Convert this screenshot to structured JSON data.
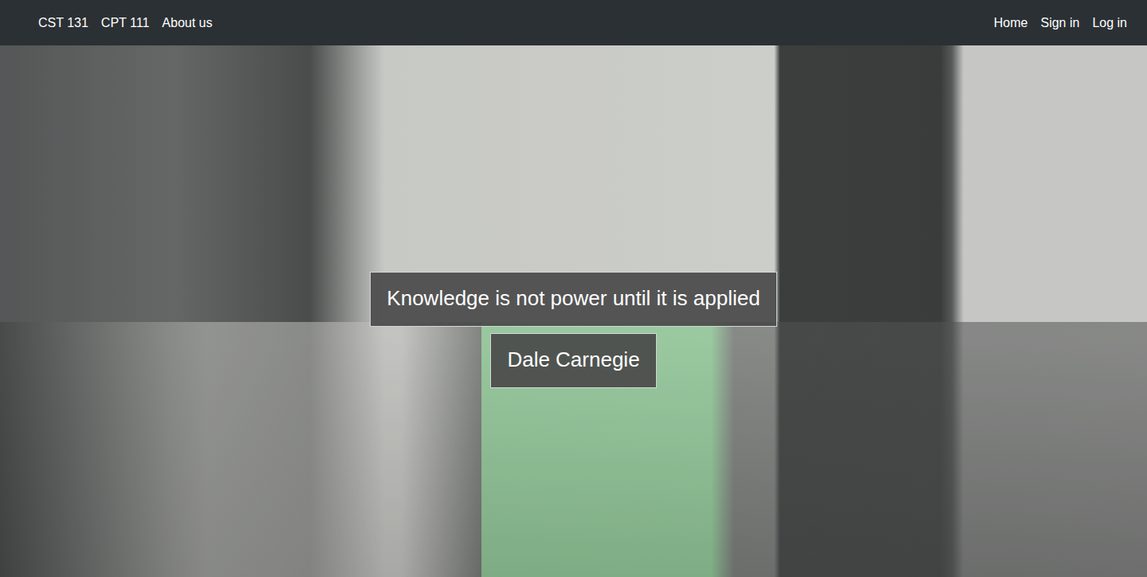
{
  "nav": {
    "left": [
      {
        "label": "CST 131"
      },
      {
        "label": "CPT 111"
      },
      {
        "label": "About us"
      }
    ],
    "right": [
      {
        "label": "Home"
      },
      {
        "label": "Sign in"
      },
      {
        "label": "Log in"
      }
    ]
  },
  "hero": {
    "quote": "Knowledge is not power until it is applied",
    "author": "Dale Carnegie"
  }
}
